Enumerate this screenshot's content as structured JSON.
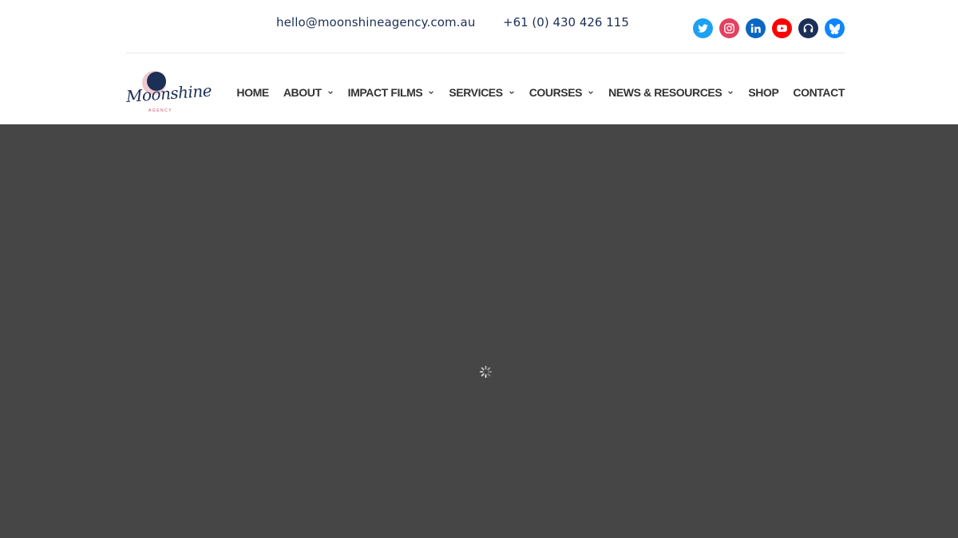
{
  "topbar": {
    "email": "hello@moonshineagency.com.au",
    "phone": "+61 (0) 430 426 115",
    "social": [
      {
        "name": "twitter-icon",
        "color": "#1da1f2"
      },
      {
        "name": "instagram-icon",
        "color": "#e4405f"
      },
      {
        "name": "linkedin-icon",
        "color": "#0a66c2"
      },
      {
        "name": "youtube-icon",
        "color": "#ff0000"
      },
      {
        "name": "podcast-icon",
        "color": "#1c2f57"
      },
      {
        "name": "bluesky-icon",
        "color": "#1185fe"
      }
    ]
  },
  "logo": {
    "name": "Moonshine",
    "sub": "AGENCY",
    "colors": {
      "navy": "#1c2f57",
      "pink": "#e59aa8"
    }
  },
  "nav": {
    "items": [
      {
        "label": "HOME",
        "dropdown": false
      },
      {
        "label": "ABOUT",
        "dropdown": true
      },
      {
        "label": "IMPACT FILMS",
        "dropdown": true
      },
      {
        "label": "SERVICES",
        "dropdown": true
      },
      {
        "label": "COURSES",
        "dropdown": true
      },
      {
        "label": "NEWS & RESOURCES",
        "dropdown": true
      },
      {
        "label": "SHOP",
        "dropdown": false
      },
      {
        "label": "CONTACT",
        "dropdown": false
      }
    ]
  },
  "hero": {
    "background": "#464646",
    "state": "loading"
  }
}
